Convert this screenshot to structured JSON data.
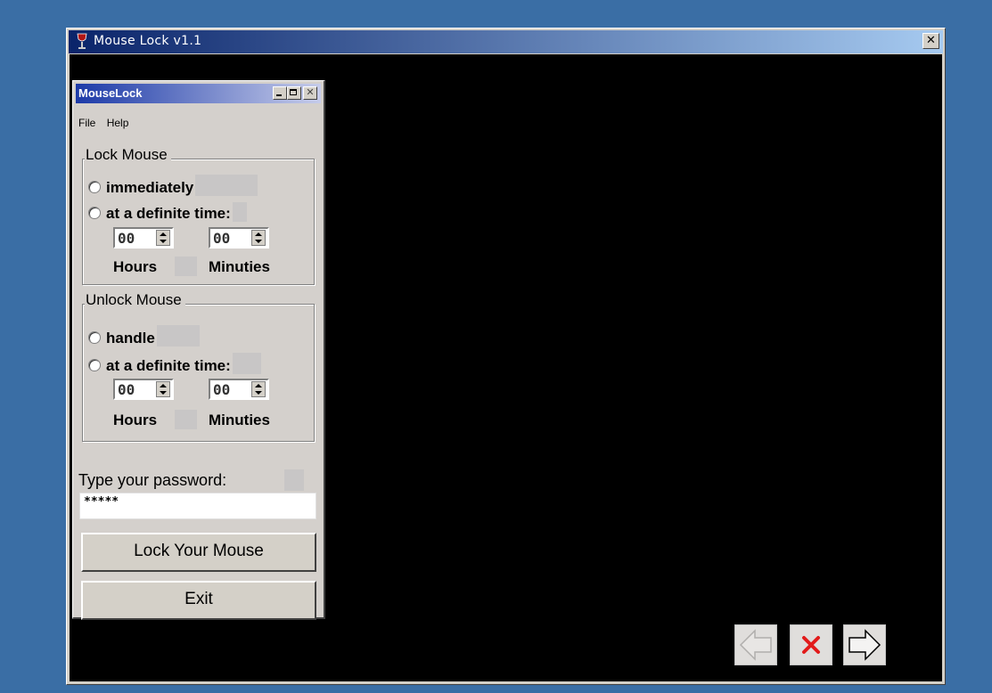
{
  "window": {
    "title": "Mouse Lock v1.1",
    "close_glyph": "✕"
  },
  "app": {
    "title": "MouseLock",
    "menu": [
      "File",
      "Help"
    ],
    "lock_group": {
      "legend": "Lock Mouse",
      "option_1": "immediately",
      "option_2": "at a definite time:",
      "hours_value": "00",
      "minutes_value": "00",
      "hours_label": "Hours",
      "minutes_label": "Minuties"
    },
    "unlock_group": {
      "legend": "Unlock Mouse",
      "option_1": "handle",
      "option_2": "at a definite time:",
      "hours_value": "00",
      "minutes_value": "00",
      "hours_label": "Hours",
      "minutes_label": "Minuties"
    },
    "password_label": "Type your password:",
    "password_value": "*****",
    "lock_button": "Lock Your Mouse",
    "exit_button": "Exit"
  },
  "nav": {
    "prev_icon": "left-arrow-icon",
    "close_icon": "red-x-icon",
    "next_icon": "right-arrow-icon"
  },
  "colors": {
    "desktop": "#3a6ea5",
    "title_gradient_start": "#0a246a",
    "title_gradient_end": "#a6caf0",
    "red_x": "#e21b1b"
  }
}
